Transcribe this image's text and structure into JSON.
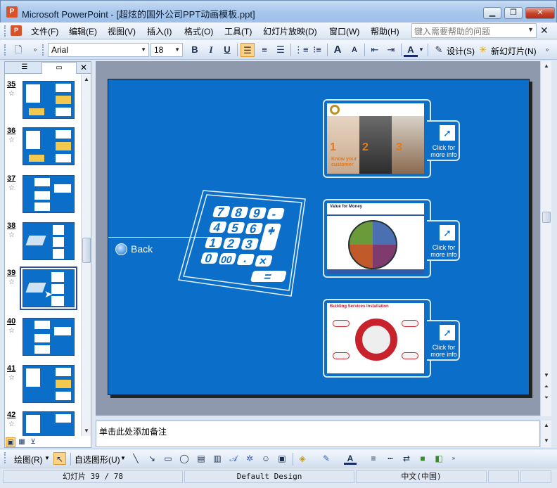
{
  "window": {
    "title": "Microsoft PowerPoint - [超炫的国外公司PPT动画模板.ppt]",
    "minimize_symbol": "▁",
    "restore_symbol": "❐",
    "close_symbol": "✕"
  },
  "menu": {
    "items": [
      "文件(F)",
      "编辑(E)",
      "视图(V)",
      "插入(I)",
      "格式(O)",
      "工具(T)",
      "幻灯片放映(D)",
      "窗口(W)",
      "帮助(H)"
    ],
    "help_placeholder": "键入需要帮助的问题",
    "close_symbol": "✕"
  },
  "format_toolbar": {
    "font_name": "Arial",
    "font_size": "18",
    "bold": "B",
    "italic": "I",
    "underline": "U",
    "grow_font": "A",
    "shrink_font": "A",
    "font_color": "A",
    "design_label": "设计(S)",
    "new_slide_label": "新幻灯片(N)",
    "align_left_active": true
  },
  "left_pane": {
    "tab_outline_icon": "outline-icon",
    "tab_slides_icon": "slides-icon",
    "close_symbol": "✕",
    "slides": [
      {
        "number": "35",
        "star": "☆"
      },
      {
        "number": "36",
        "star": "☆"
      },
      {
        "number": "37",
        "star": "☆"
      },
      {
        "number": "38",
        "star": "☆"
      },
      {
        "number": "39",
        "star": "☆",
        "selected": true
      },
      {
        "number": "40",
        "star": "☆"
      },
      {
        "number": "41",
        "star": "☆"
      },
      {
        "number": "42",
        "star": "☆"
      }
    ]
  },
  "slide": {
    "back_label": "Back",
    "calculator_keys": [
      "7",
      "8",
      "9",
      "-",
      "4",
      "5",
      "6",
      "÷",
      "1",
      "2",
      "3",
      "+",
      "×",
      "0",
      "00",
      ".",
      "="
    ],
    "cards": [
      {
        "click_text": "Click for more info",
        "caption": "Know your customer",
        "numbers": [
          "1",
          "2",
          "3"
        ]
      },
      {
        "click_text": "Click for more info",
        "caption": "Value for Money"
      },
      {
        "click_text": "Click for more info",
        "caption": "Building Services Installation"
      }
    ]
  },
  "notes": {
    "placeholder": "单击此处添加备注"
  },
  "draw_toolbar": {
    "draw_label": "绘图(R)",
    "autoshapes_label": "自选图形(U)"
  },
  "status": {
    "slide_counter": "幻灯片 39 / 78",
    "design": "Default Design",
    "language": "中文(中国)"
  }
}
